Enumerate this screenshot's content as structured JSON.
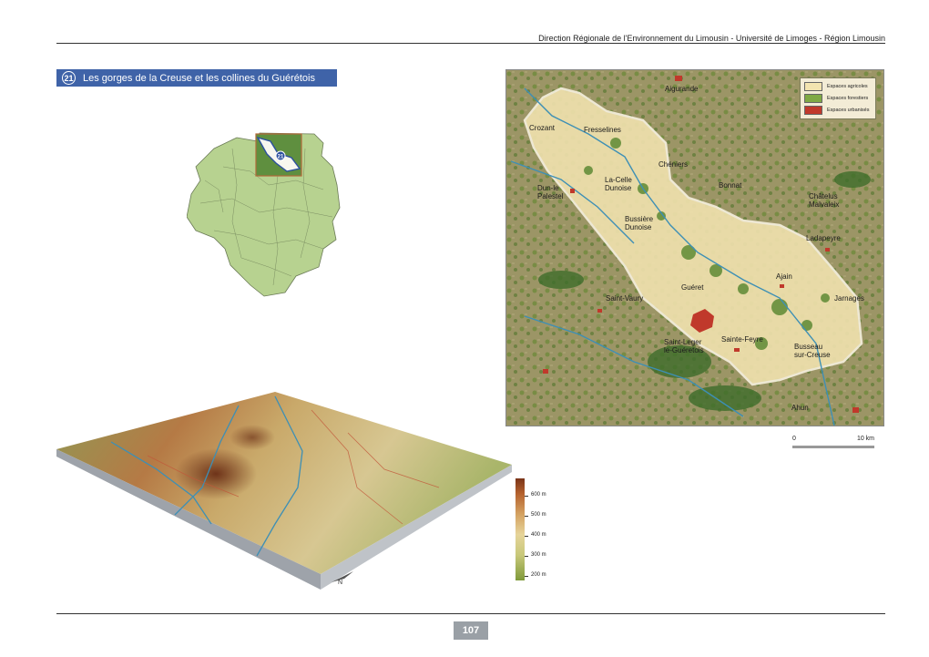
{
  "header": {
    "text": "Direction Régionale de l'Environnement du Limousin - Université de Limoges - Région Limousin"
  },
  "section": {
    "number": "21",
    "title": "Les gorges de la Creuse et les collines du Guérétois"
  },
  "locator": {
    "badge": "21"
  },
  "map": {
    "places": [
      {
        "id": "aigurande",
        "label": "Aigurande"
      },
      {
        "id": "crozant",
        "label": "Crozant"
      },
      {
        "id": "fresselines",
        "label": "Fresselines"
      },
      {
        "id": "cheniers",
        "label": "Chéniers"
      },
      {
        "id": "la-celle",
        "label": "La-Celle\nDunoise"
      },
      {
        "id": "dun",
        "label": "Dun-le\nPalestel"
      },
      {
        "id": "bonnat",
        "label": "Bonnat"
      },
      {
        "id": "chatelus",
        "label": "Châtelus\nMalvaleix"
      },
      {
        "id": "bussiere",
        "label": "Bussière\nDunoise"
      },
      {
        "id": "ladapeyre",
        "label": "Ladapeyre"
      },
      {
        "id": "ajain",
        "label": "Ajain"
      },
      {
        "id": "gueret",
        "label": "Guéret"
      },
      {
        "id": "saint-vaury",
        "label": "Saint-Vaury"
      },
      {
        "id": "jarnages",
        "label": "Jarnages"
      },
      {
        "id": "sainte-feyre",
        "label": "Sainte-Feyre"
      },
      {
        "id": "saint-leger",
        "label": "Saint-Leger\nle-Guéretois"
      },
      {
        "id": "busseau",
        "label": "Busseau\nsur-Creuse"
      },
      {
        "id": "ahun",
        "label": "Ahun"
      }
    ],
    "legend": [
      {
        "label": "Espaces agricoles",
        "color": "#f3e4b0"
      },
      {
        "label": "Espaces forestiers",
        "color": "#7fa944"
      },
      {
        "label": "Espaces urbanisés",
        "color": "#c0392b"
      }
    ]
  },
  "scale": {
    "start": "0",
    "end": "10 km"
  },
  "elevation_legend": {
    "labels": [
      "600 m",
      "500 m",
      "400 m",
      "300 m",
      "200 m"
    ]
  },
  "compass": {
    "label": "N"
  },
  "page_number": "107"
}
